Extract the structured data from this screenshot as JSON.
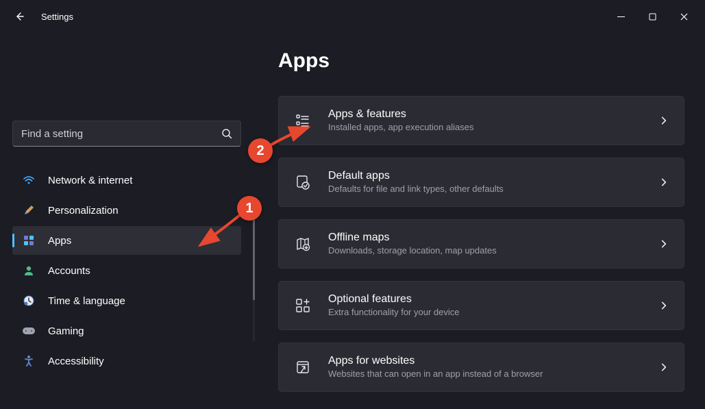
{
  "window": {
    "title": "Settings"
  },
  "search": {
    "placeholder": "Find a setting"
  },
  "nav": {
    "items": [
      {
        "label": "Network & internet",
        "icon": "wifi"
      },
      {
        "label": "Personalization",
        "icon": "brush"
      },
      {
        "label": "Apps",
        "icon": "apps"
      },
      {
        "label": "Accounts",
        "icon": "person"
      },
      {
        "label": "Time & language",
        "icon": "clock"
      },
      {
        "label": "Gaming",
        "icon": "gamepad"
      },
      {
        "label": "Accessibility",
        "icon": "accessibility"
      }
    ],
    "activeIndex": 2
  },
  "page": {
    "title": "Apps"
  },
  "cards": [
    {
      "title": "Apps & features",
      "subtitle": "Installed apps, app execution aliases",
      "icon": "list"
    },
    {
      "title": "Default apps",
      "subtitle": "Defaults for file and link types, other defaults",
      "icon": "default"
    },
    {
      "title": "Offline maps",
      "subtitle": "Downloads, storage location, map updates",
      "icon": "map"
    },
    {
      "title": "Optional features",
      "subtitle": "Extra functionality for your device",
      "icon": "plus-grid"
    },
    {
      "title": "Apps for websites",
      "subtitle": "Websites that can open in an app instead of a browser",
      "icon": "web-window"
    }
  ],
  "annotations": {
    "badge1": "1",
    "badge2": "2"
  }
}
